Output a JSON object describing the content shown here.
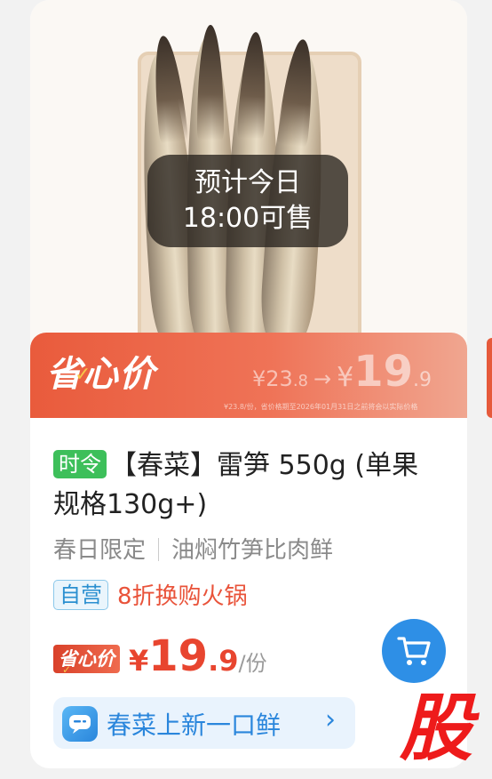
{
  "image": {
    "eta_line1": "预计今日",
    "eta_line2": "18:00可售"
  },
  "banner": {
    "title": "省心价",
    "old_price_symbol": "¥",
    "old_price_int": "23",
    "old_price_dec": ".8",
    "arrow": "→",
    "new_price_symbol": "¥",
    "new_price_int": "19",
    "new_price_dec": ".9",
    "fineprint": "¥23.8/份，省价格期至2026年01月31日之前将会以实际价格"
  },
  "product": {
    "season_tag": "时令",
    "title": "【春菜】雷笋 550g (单果规格130g+)",
    "subtitle_left": "春日限定",
    "subtitle_right": "油焖竹笋比肉鲜",
    "self_operated_tag": "自营",
    "promo": "8折换购火锅"
  },
  "price": {
    "badge": "省心价",
    "symbol": "¥",
    "integer": "19",
    "decimal": ".9",
    "unit": "/份"
  },
  "rank": {
    "text": "春菜上新一口鲜",
    "chevron": "›"
  },
  "watermark": {
    "text": "股"
  },
  "colors": {
    "accent_red": "#e8452f",
    "season_green": "#3dbf5a",
    "cart_blue": "#2e8fe6"
  }
}
